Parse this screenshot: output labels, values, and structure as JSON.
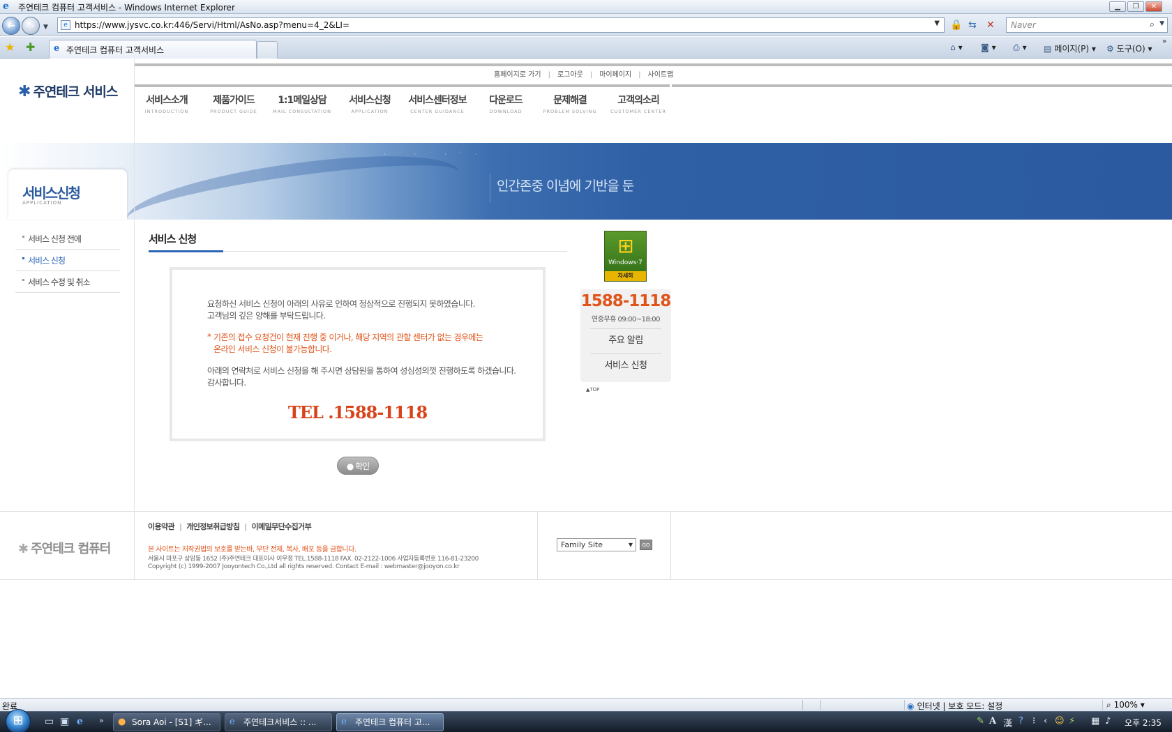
{
  "window": {
    "title": "주연테크 컴퓨터 고객서비스 - Windows Internet Explorer",
    "address": "https://www.jysvc.co.kr:446/Servi/Html/AsNo.asp?menu=4_2&LI=",
    "search_placeholder": "Naver",
    "tab_title": "주연테크 컴퓨터 고객서비스",
    "commands": {
      "page": "페이지(P)",
      "tools": "도구(O)"
    },
    "status_text": "완료",
    "zone_text": "인터넷 | 보호 모드: 설정",
    "zoom_text": "100%"
  },
  "site": {
    "logo_text": "주연테크 서비스",
    "util_links": [
      "홈페이지로 가기",
      "로그아웃",
      "마이페이지",
      "사이트맵"
    ],
    "gnb": [
      {
        "ko": "서비스소개",
        "en": "INTRODUCTION"
      },
      {
        "ko": "제품가이드",
        "en": "PRODUCT GUIDE"
      },
      {
        "ko": "1:1메일상담",
        "en": "MAIL CONSULTATION"
      },
      {
        "ko": "서비스신청",
        "en": "APPLICATION"
      },
      {
        "ko": "서비스센터정보",
        "en": "CENTER GUIDANCE"
      },
      {
        "ko": "다운로드",
        "en": "DOWNLOAD"
      },
      {
        "ko": "문제해결",
        "en": "PROBLEM SOLVING"
      },
      {
        "ko": "고객의소리",
        "en": "CUSTOMER CENTER"
      }
    ],
    "banner_text": "인간존중 이념에 기반을 둔",
    "section_title": "서비스신청",
    "section_sub": "APPLICATION",
    "side_menu": [
      {
        "label": "서비스 신청 전에",
        "active": false
      },
      {
        "label": "서비스 신청",
        "active": true
      },
      {
        "label": "서비스 수정 및 취소",
        "active": false
      }
    ]
  },
  "content": {
    "title": "서비스 신청",
    "line1": "요청하신 서비스 신청이 아래의 사유로 인하여 정상적으로 진행되지 못하였습니다.",
    "line2": "고객님의 깊은 양해를 부탁드립니다.",
    "warn_star": "*",
    "warn1": "기존의 접수 요청건이 현재 진행 중 이거나, 해당 지역의 관할 센터가 없는 경우에는",
    "warn2": "온라인 서비스 신청이 불가능합니다.",
    "line3": "아래의 연락처로 서비스 신청을 해 주시면 상담원을 통하여 성심성의껏 진행하도록 하겠습니다.",
    "line4": "감사합니다.",
    "tel": "TEL .1588-1118",
    "ok_button": "● 확인"
  },
  "quick": {
    "win7_label": "Windows·7",
    "win7_more": "자세히",
    "tel": "1588-1118",
    "hours": "연중무휴 09:00~18:00",
    "items": [
      "주요 알림",
      "서비스 신청"
    ],
    "top": "▲TOP"
  },
  "footer": {
    "logo_text": "주연테크 컴퓨터",
    "links": [
      "이용약관",
      "개인정보취급방침",
      "이메일무단수집거부"
    ],
    "warn": "본 사이트는 저작권법의 보호를 받는바, 무단 전제, 복사, 배포 등을 금합니다.",
    "addr": "서울시 마포구 상암동 1652 (주)주연테크 대표이사 이우정   TEL.1588-1118   FAX. 02-2122-1006   사업자등록번호 116-81-23200",
    "copy": "Copyright (c) 1999-2007 Jooyontech Co.,Ltd all rights reserved.     Contact E-mail : webmaster@jooyon.co.kr",
    "family_site": "Family Site",
    "go": "GO"
  },
  "taskbar": {
    "tasks": [
      "Sora Aoi - [S1] ギ...",
      "주연테크서비스 :: ...",
      "주연테크 컴퓨터 고..."
    ],
    "clock": "오후 2:35"
  }
}
